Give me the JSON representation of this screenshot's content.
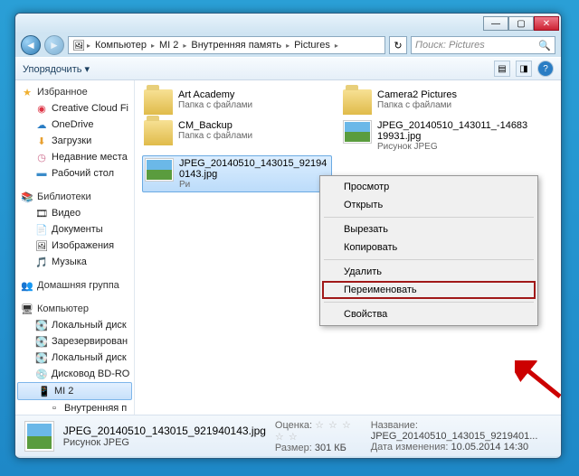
{
  "breadcrumb": [
    "Компьютер",
    "MI 2",
    "Внутренняя память",
    "Pictures"
  ],
  "search_placeholder": "Поиск: Pictures",
  "toolbar": {
    "organize": "Упорядочить ▾"
  },
  "sidebar": {
    "fav": {
      "label": "Избранное",
      "items": [
        "Creative Cloud Fi",
        "OneDrive",
        "Загрузки",
        "Недавние места",
        "Рабочий стол"
      ]
    },
    "lib": {
      "label": "Библиотеки",
      "items": [
        "Видео",
        "Документы",
        "Изображения",
        "Музыка"
      ]
    },
    "home": {
      "label": "Домашняя группа"
    },
    "comp": {
      "label": "Компьютер",
      "items": [
        "Локальный диск",
        "Зарезервирован",
        "Локальный диск",
        "Дисковод BD-RO",
        "MI 2",
        "Внутренняя п"
      ]
    }
  },
  "files": [
    {
      "name": "Art Academy",
      "sub": "Папка с файлами",
      "kind": "folder"
    },
    {
      "name": "Camera2 Pictures",
      "sub": "Папка с файлами",
      "kind": "folder"
    },
    {
      "name": "CM_Backup",
      "sub": "Папка с файлами",
      "kind": "folder"
    },
    {
      "name": "JPEG_20140510_143011_-1468319931.jpg",
      "sub": "Рисунок JPEG",
      "kind": "image"
    },
    {
      "name": "JPEG_20140510_143015_921940143.jpg",
      "sub": "Ри",
      "kind": "image"
    }
  ],
  "context_menu": [
    "Просмотр",
    "Открыть",
    "—",
    "Вырезать",
    "Копировать",
    "—",
    "Удалить",
    "Переименовать",
    "—",
    "Свойства"
  ],
  "details": {
    "name": "JPEG_20140510_143015_921940143.jpg",
    "type": "Рисунок JPEG",
    "rating_label": "Оценка:",
    "size_label": "Размер:",
    "size": "301 КБ",
    "title_label": "Название:",
    "title": "JPEG_20140510_143015_9219401...",
    "date_label": "Дата изменения:",
    "date": "10.05.2014 14:30"
  }
}
